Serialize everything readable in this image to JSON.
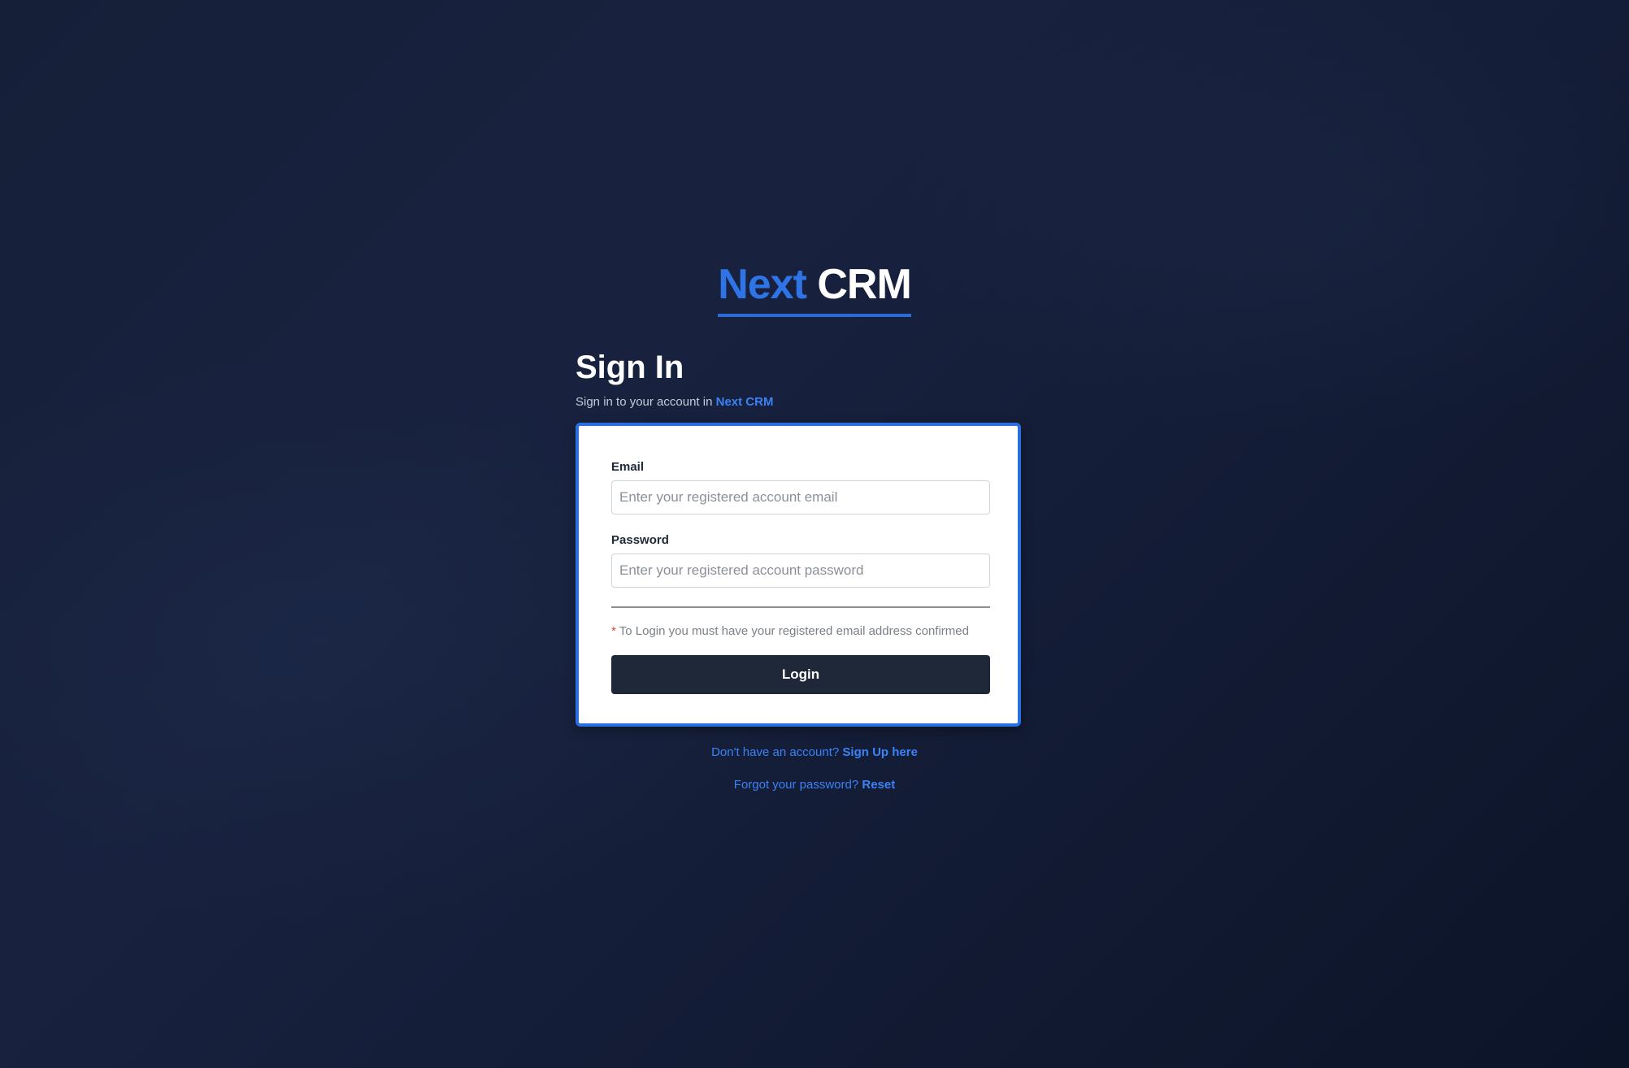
{
  "brand": {
    "name_part1": "Next",
    "name_part2": "CRM"
  },
  "heading": {
    "title": "Sign In",
    "subtitle_prefix": "Sign in to your account in",
    "subtitle_brand": "Next CRM"
  },
  "form": {
    "email_label": "Email",
    "email_placeholder": "Enter your registered account email",
    "password_label": "Password",
    "password_placeholder": "Enter your registered account password",
    "note_marker": "*",
    "note_text": "To Login you must have your registered email address confirmed",
    "login_label": "Login"
  },
  "links": {
    "signup_prefix": "Don't have an account?",
    "signup_link": "Sign Up here",
    "reset_prefix": "Forgot your password?",
    "reset_link": "Reset"
  },
  "colors": {
    "accent": "#2f74e6",
    "background": "#161f38",
    "button": "#1e2838",
    "required_marker": "#e0453a"
  }
}
